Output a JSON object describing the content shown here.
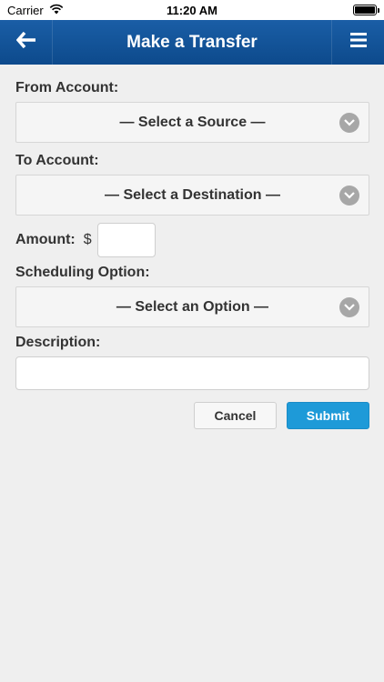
{
  "status_bar": {
    "carrier": "Carrier",
    "time": "11:20 AM",
    "battery_level": 1.0,
    "wifi_icon": "wifi-icon",
    "battery_icon": "battery-icon"
  },
  "nav": {
    "title": "Make a Transfer",
    "back_icon": "back-arrow-icon",
    "menu_icon": "hamburger-menu-icon",
    "bar_color": "#0d4a8c"
  },
  "form": {
    "from_label": "From Account:",
    "from_value": "— Select a Source —",
    "to_label": "To Account:",
    "to_value": "— Select a Destination —",
    "amount_label": "Amount:",
    "currency_symbol": "$",
    "amount_value": "",
    "schedule_label": "Scheduling Option:",
    "schedule_value": "— Select an Option —",
    "description_label": "Description:",
    "description_value": "",
    "cancel_label": "Cancel",
    "submit_label": "Submit",
    "submit_color": "#1e9ad8"
  }
}
